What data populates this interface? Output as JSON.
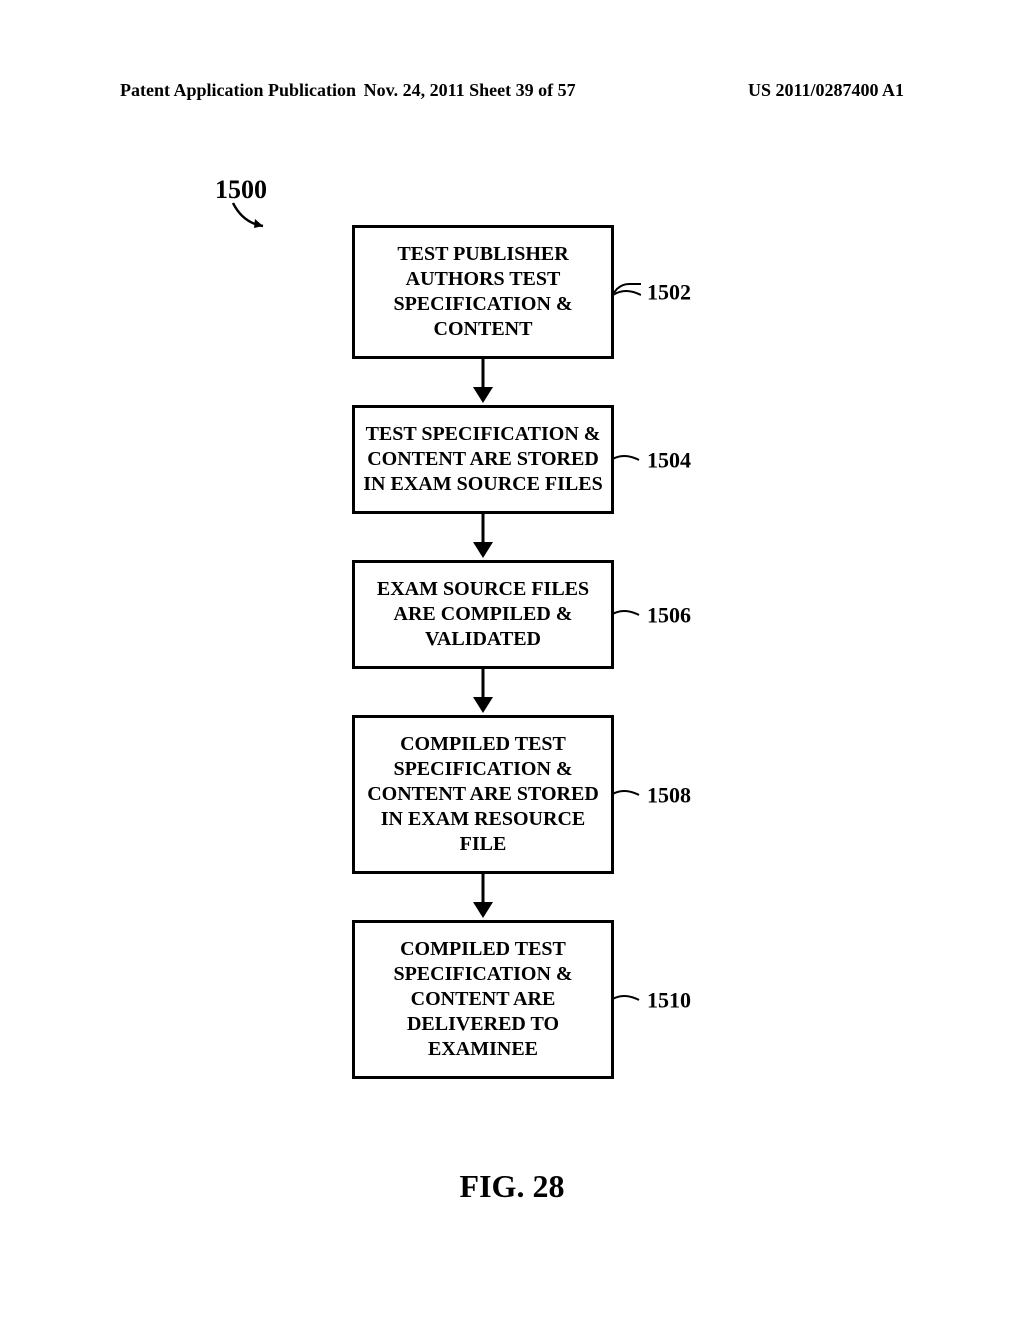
{
  "header": {
    "left": "Patent Application Publication",
    "center": "Nov. 24, 2011  Sheet 39 of 57",
    "right": "US 2011/0287400 A1"
  },
  "diagram": {
    "ref": "1500",
    "boxes": [
      {
        "text": "TEST PUBLISHER AUTHORS TEST SPECIFICATION & CONTENT",
        "callout": "1502"
      },
      {
        "text": "TEST SPECIFICATION & CONTENT ARE STORED IN EXAM SOURCE FILES",
        "callout": "1504"
      },
      {
        "text": "EXAM SOURCE FILES ARE COMPILED & VALIDATED",
        "callout": "1506"
      },
      {
        "text": "COMPILED TEST SPECIFICATION & CONTENT ARE STORED IN EXAM RESOURCE FILE",
        "callout": "1508"
      },
      {
        "text": "COMPILED TEST SPECIFICATION & CONTENT ARE DELIVERED TO EXAMINEE",
        "callout": "1510"
      }
    ]
  },
  "figure_label": "FIG. 28",
  "chart_data": {
    "type": "flowchart",
    "title": "FIG. 28",
    "ref_number": "1500",
    "nodes": [
      {
        "id": "1502",
        "label": "TEST PUBLISHER AUTHORS TEST SPECIFICATION & CONTENT"
      },
      {
        "id": "1504",
        "label": "TEST SPECIFICATION & CONTENT ARE STORED IN EXAM SOURCE FILES"
      },
      {
        "id": "1506",
        "label": "EXAM SOURCE FILES ARE COMPILED & VALIDATED"
      },
      {
        "id": "1508",
        "label": "COMPILED TEST SPECIFICATION & CONTENT ARE STORED IN EXAM RESOURCE FILE"
      },
      {
        "id": "1510",
        "label": "COMPILED TEST SPECIFICATION & CONTENT ARE DELIVERED TO EXAMINEE"
      }
    ],
    "edges": [
      {
        "from": "1502",
        "to": "1504"
      },
      {
        "from": "1504",
        "to": "1506"
      },
      {
        "from": "1506",
        "to": "1508"
      },
      {
        "from": "1508",
        "to": "1510"
      }
    ]
  }
}
